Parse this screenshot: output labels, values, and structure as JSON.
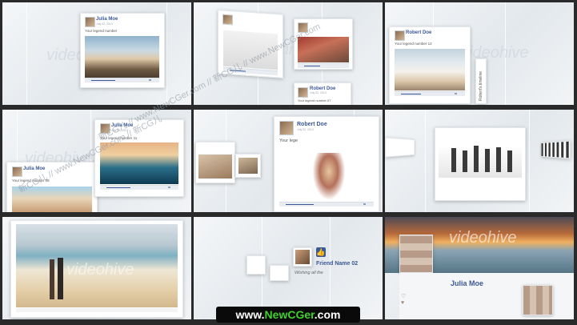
{
  "profiles": {
    "julia": {
      "name": "Julia Moe",
      "date": "July 02, 2013",
      "legend": "Your legend number"
    },
    "julia_2": {
      "name": "Julia Moe",
      "date": "July 02, 2013",
      "legend": "Your legend number 11"
    },
    "julia_3": {
      "name": "Julia Moe",
      "legend": "Your legend number 08"
    },
    "robert": {
      "name": "Robert Doe",
      "date": "July 02, 2013",
      "legend": "Your legend number 07"
    },
    "robert_2": {
      "name": "Robert Doe",
      "date": "July 02, 2013",
      "legend": "Your lege"
    },
    "robert_3": {
      "name": "Robert Doe",
      "legend": "Your legend number 12"
    },
    "friend": {
      "name": "Friend Name 02",
      "message": "Wishing all the"
    },
    "julia_big": {
      "name": "Julia Moe"
    }
  },
  "side_tab": "Robert's timeline",
  "watermarks": {
    "diag": "新CG儿 // www.NewCGer.com // 新CG儿 // www.NewCGer.com",
    "diag2": "新CG儿 // www.NewCGer.com // 新CG儿",
    "brand": "videohive"
  },
  "banner": {
    "prefix": "www.",
    "brand": "NewCGer",
    "suffix": ".com"
  },
  "colors": {
    "accent": "#3b5998",
    "banner_green": "#3fd12b",
    "background": "#e8ecef"
  }
}
